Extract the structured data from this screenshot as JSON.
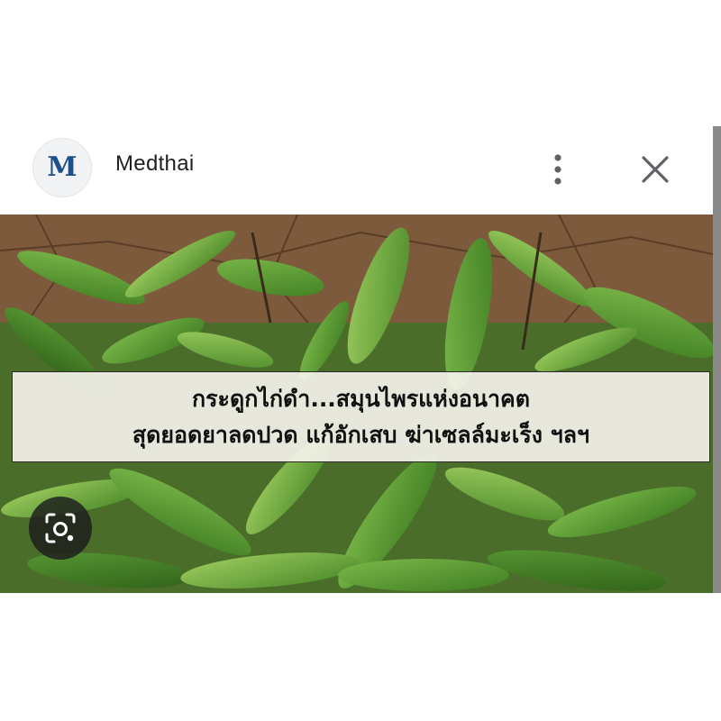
{
  "header": {
    "logo_letter": "M",
    "site_name": "Medthai",
    "more_icon": "more-vertical-icon",
    "close_icon": "close-icon"
  },
  "image": {
    "caption_lines": [
      "กระดูกไก่ดำ...สมุนไพรแห่งอนาคต",
      "สุดยอดยาลดปวด แก้อักเสบ ฆ่าเซลล์มะเร็ง ฯลฯ"
    ],
    "lens_icon": "visual-search-icon"
  },
  "colors": {
    "logo_blue": "#1e4f8c",
    "text_dark": "#202124",
    "icon_gray": "#5f6368",
    "scrollbar": "#8a8a8a"
  }
}
